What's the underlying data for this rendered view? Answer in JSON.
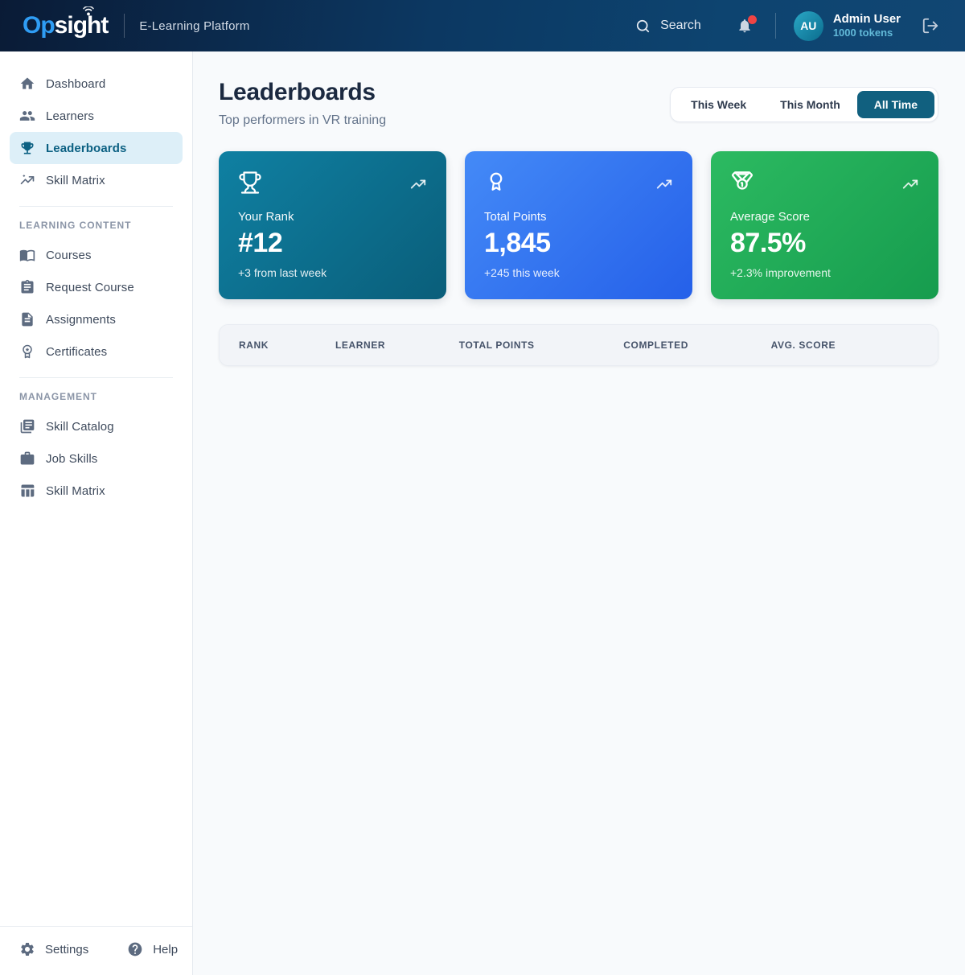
{
  "header": {
    "logo": {
      "prefix": "Op",
      "mid": "si",
      "suffix": "ght"
    },
    "platform_label": "E-Learning Platform",
    "search_label": "Search",
    "user": {
      "initials": "AU",
      "name": "Admin User",
      "tokens": "1000 tokens"
    }
  },
  "sidebar": {
    "items": [
      {
        "label": "Dashboard",
        "icon": "home-icon"
      },
      {
        "label": "Learners",
        "icon": "users-icon"
      },
      {
        "label": "Leaderboards",
        "icon": "trophy-icon",
        "active": true
      },
      {
        "label": "Skill Matrix",
        "icon": "trending-up-icon"
      }
    ],
    "sections": [
      {
        "title": "LEARNING CONTENT",
        "items": [
          {
            "label": "Courses",
            "icon": "book-icon"
          },
          {
            "label": "Request Course",
            "icon": "clipboard-icon"
          },
          {
            "label": "Assignments",
            "icon": "file-icon"
          },
          {
            "label": "Certificates",
            "icon": "certificate-icon"
          }
        ]
      },
      {
        "title": "MANAGEMENT",
        "items": [
          {
            "label": "Skill Catalog",
            "icon": "library-icon"
          },
          {
            "label": "Job Skills",
            "icon": "briefcase-icon"
          },
          {
            "label": "Skill Matrix",
            "icon": "table-icon"
          }
        ]
      }
    ],
    "footer": {
      "settings_label": "Settings",
      "help_label": "Help"
    }
  },
  "main": {
    "title": "Leaderboards",
    "subtitle": "Top performers in VR training",
    "filters": {
      "options": [
        {
          "label": "This Week",
          "active": false
        },
        {
          "label": "This Month",
          "active": false
        },
        {
          "label": "All Time",
          "active": true
        }
      ]
    },
    "stats": [
      {
        "label": "Your Rank",
        "value": "#12",
        "delta": "+3 from last week",
        "icon": "trophy-icon",
        "trend_icon": "trending-up-icon",
        "color": "#0f80a2"
      },
      {
        "label": "Total Points",
        "value": "1,845",
        "delta": "+245 this week",
        "icon": "award-icon",
        "trend_icon": "trending-up-icon",
        "color": "#3b82f6"
      },
      {
        "label": "Average Score",
        "value": "87.5%",
        "delta": "+2.3% improvement",
        "icon": "medal-icon",
        "trend_icon": "trending-up-icon",
        "color": "#22ab58"
      }
    ],
    "table": {
      "columns": [
        "RANK",
        "LEARNER",
        "TOTAL POINTS",
        "COMPLETED",
        "AVG. SCORE"
      ],
      "rows": []
    }
  },
  "colors": {
    "topbar_gradient_start": "#0a1b36",
    "topbar_gradient_end": "#114673",
    "brand_blue": "#2f9df4",
    "accent_teal": "#11607f",
    "active_item_bg": "#ddeff8",
    "notification_dot": "#ef4444",
    "tokens_text": "#62b9d8",
    "card_teal_from": "#0f80a2",
    "card_teal_to": "#0a5e7a",
    "card_blue_from": "#448af7",
    "card_blue_to": "#2560e9",
    "card_green_from": "#2cba61",
    "card_green_to": "#169c4e",
    "page_bg": "#f8fafc"
  }
}
